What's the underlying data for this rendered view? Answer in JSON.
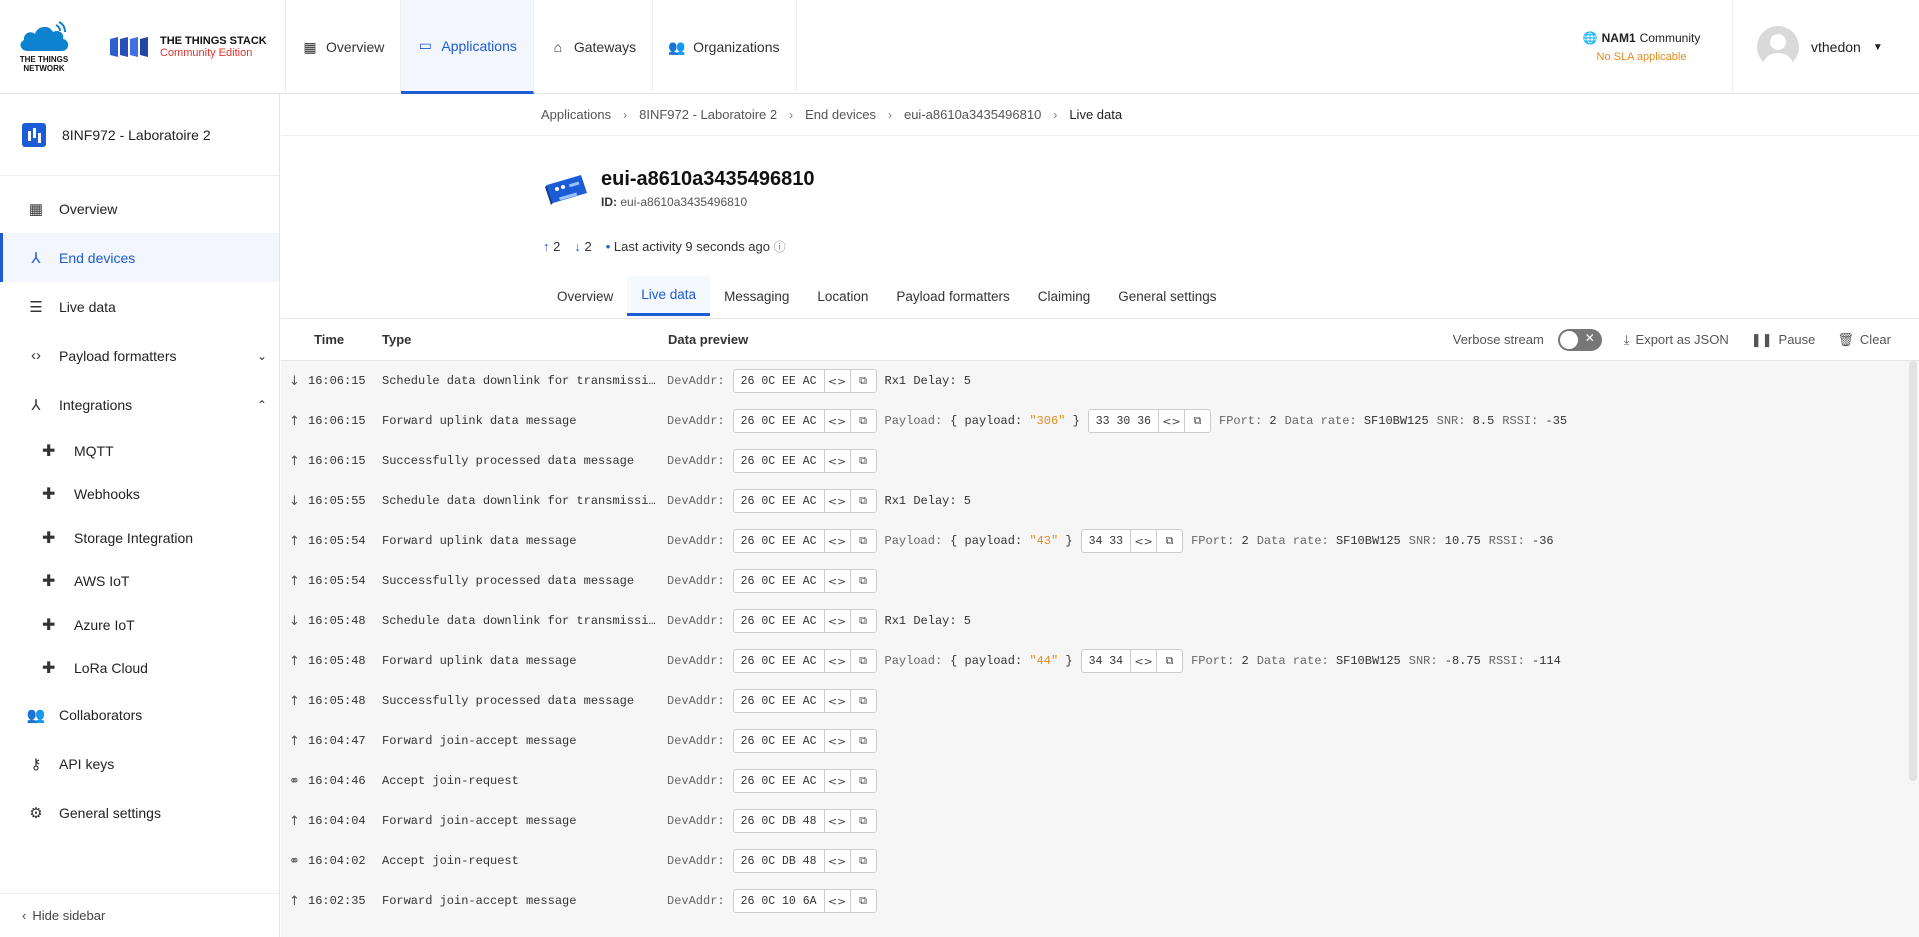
{
  "brand": {
    "ttn_line1": "THE THINGS",
    "ttn_line2": "NETWORK",
    "stack_line1": "THE THINGS STACK",
    "stack_line2": "Community Edition"
  },
  "nav": [
    {
      "label": "Overview",
      "icon": "dashboard-icon"
    },
    {
      "label": "Applications",
      "icon": "application-icon",
      "active": true
    },
    {
      "label": "Gateways",
      "icon": "router-icon"
    },
    {
      "label": "Organizations",
      "icon": "people-icon"
    }
  ],
  "cluster": {
    "name": "NAM1",
    "tier": "Community",
    "sla": "No SLA applicable"
  },
  "user": {
    "name": "vthedon"
  },
  "sidebar": {
    "app_name": "8INF972 - Laboratoire 2",
    "items": [
      {
        "label": "Overview"
      },
      {
        "label": "End devices",
        "active": true
      },
      {
        "label": "Live data"
      },
      {
        "label": "Payload formatters"
      },
      {
        "label": "Integrations"
      }
    ],
    "integrations": [
      "MQTT",
      "Webhooks",
      "Storage Integration",
      "AWS IoT",
      "Azure IoT",
      "LoRa Cloud"
    ],
    "bottom_items": [
      {
        "label": "Collaborators"
      },
      {
        "label": "API keys"
      },
      {
        "label": "General settings"
      }
    ],
    "hide_label": "Hide sidebar"
  },
  "breadcrumb": [
    "Applications",
    "8INF972 - Laboratoire 2",
    "End devices",
    "eui-a8610a3435496810",
    "Live data"
  ],
  "device": {
    "name": "eui-a8610a3435496810",
    "id_label": "ID:",
    "id": "eui-a8610a3435496810",
    "uplinks": "2",
    "downlinks": "2",
    "last_activity": "Last activity 9 seconds ago"
  },
  "tabs": [
    "Overview",
    "Live data",
    "Messaging",
    "Location",
    "Payload formatters",
    "Claiming",
    "General settings"
  ],
  "table": {
    "headers": {
      "time": "Time",
      "type": "Type",
      "preview": "Data preview"
    },
    "controls": {
      "verbose": "Verbose stream",
      "export": "Export as JSON",
      "pause": "Pause",
      "clear": "Clear"
    },
    "rows": [
      {
        "dir": "down",
        "time": "16:06:15",
        "type": "Schedule data downlink for transmissi…",
        "devaddr": "26 0C EE AC",
        "extra": "Rx1 Delay: 5"
      },
      {
        "dir": "up",
        "time": "16:06:15",
        "type": "Forward uplink data message",
        "devaddr": "26 0C EE AC",
        "payload_str": "\"306\"",
        "payload_hex": "33 30 36",
        "fport": "2",
        "datarate": "SF10BW125",
        "snr": "8.5",
        "rssi": "-35"
      },
      {
        "dir": "up",
        "time": "16:06:15",
        "type": "Successfully processed data message",
        "devaddr": "26 0C EE AC"
      },
      {
        "dir": "down",
        "time": "16:05:55",
        "type": "Schedule data downlink for transmissi…",
        "devaddr": "26 0C EE AC",
        "extra": "Rx1 Delay: 5"
      },
      {
        "dir": "up",
        "time": "16:05:54",
        "type": "Forward uplink data message",
        "devaddr": "26 0C EE AC",
        "payload_str": "\"43\"",
        "payload_hex": "34 33",
        "fport": "2",
        "datarate": "SF10BW125",
        "snr": "10.75",
        "rssi": "-36"
      },
      {
        "dir": "up",
        "time": "16:05:54",
        "type": "Successfully processed data message",
        "devaddr": "26 0C EE AC"
      },
      {
        "dir": "down",
        "time": "16:05:48",
        "type": "Schedule data downlink for transmissi…",
        "devaddr": "26 0C EE AC",
        "extra": "Rx1 Delay: 5"
      },
      {
        "dir": "up",
        "time": "16:05:48",
        "type": "Forward uplink data message",
        "devaddr": "26 0C EE AC",
        "payload_str": "\"44\"",
        "payload_hex": "34 34",
        "fport": "2",
        "datarate": "SF10BW125",
        "snr": "-8.75",
        "rssi": "-114"
      },
      {
        "dir": "up",
        "time": "16:05:48",
        "type": "Successfully processed data message",
        "devaddr": "26 0C EE AC"
      },
      {
        "dir": "up",
        "time": "16:04:47",
        "type": "Forward join-accept message",
        "devaddr": "26 0C EE AC"
      },
      {
        "dir": "link",
        "time": "16:04:46",
        "type": "Accept join-request",
        "devaddr": "26 0C EE AC"
      },
      {
        "dir": "up",
        "time": "16:04:04",
        "type": "Forward join-accept message",
        "devaddr": "26 0C DB 48"
      },
      {
        "dir": "link",
        "time": "16:04:02",
        "type": "Accept join-request",
        "devaddr": "26 0C DB 48"
      },
      {
        "dir": "up",
        "time": "16:02:35",
        "type": "Forward join-accept message",
        "devaddr": "26 0C 10 6A"
      }
    ]
  },
  "labels": {
    "devaddr": "DevAddr:",
    "payload": "Payload:",
    "payload_key": "payload:",
    "fport": "FPort:",
    "datarate": "Data rate:",
    "snr": "SNR:",
    "rssi": "RSSI:"
  },
  "colors": {
    "accent": "#1c5cd7",
    "warning": "#e38b1f",
    "brand_red": "#e0312b"
  }
}
